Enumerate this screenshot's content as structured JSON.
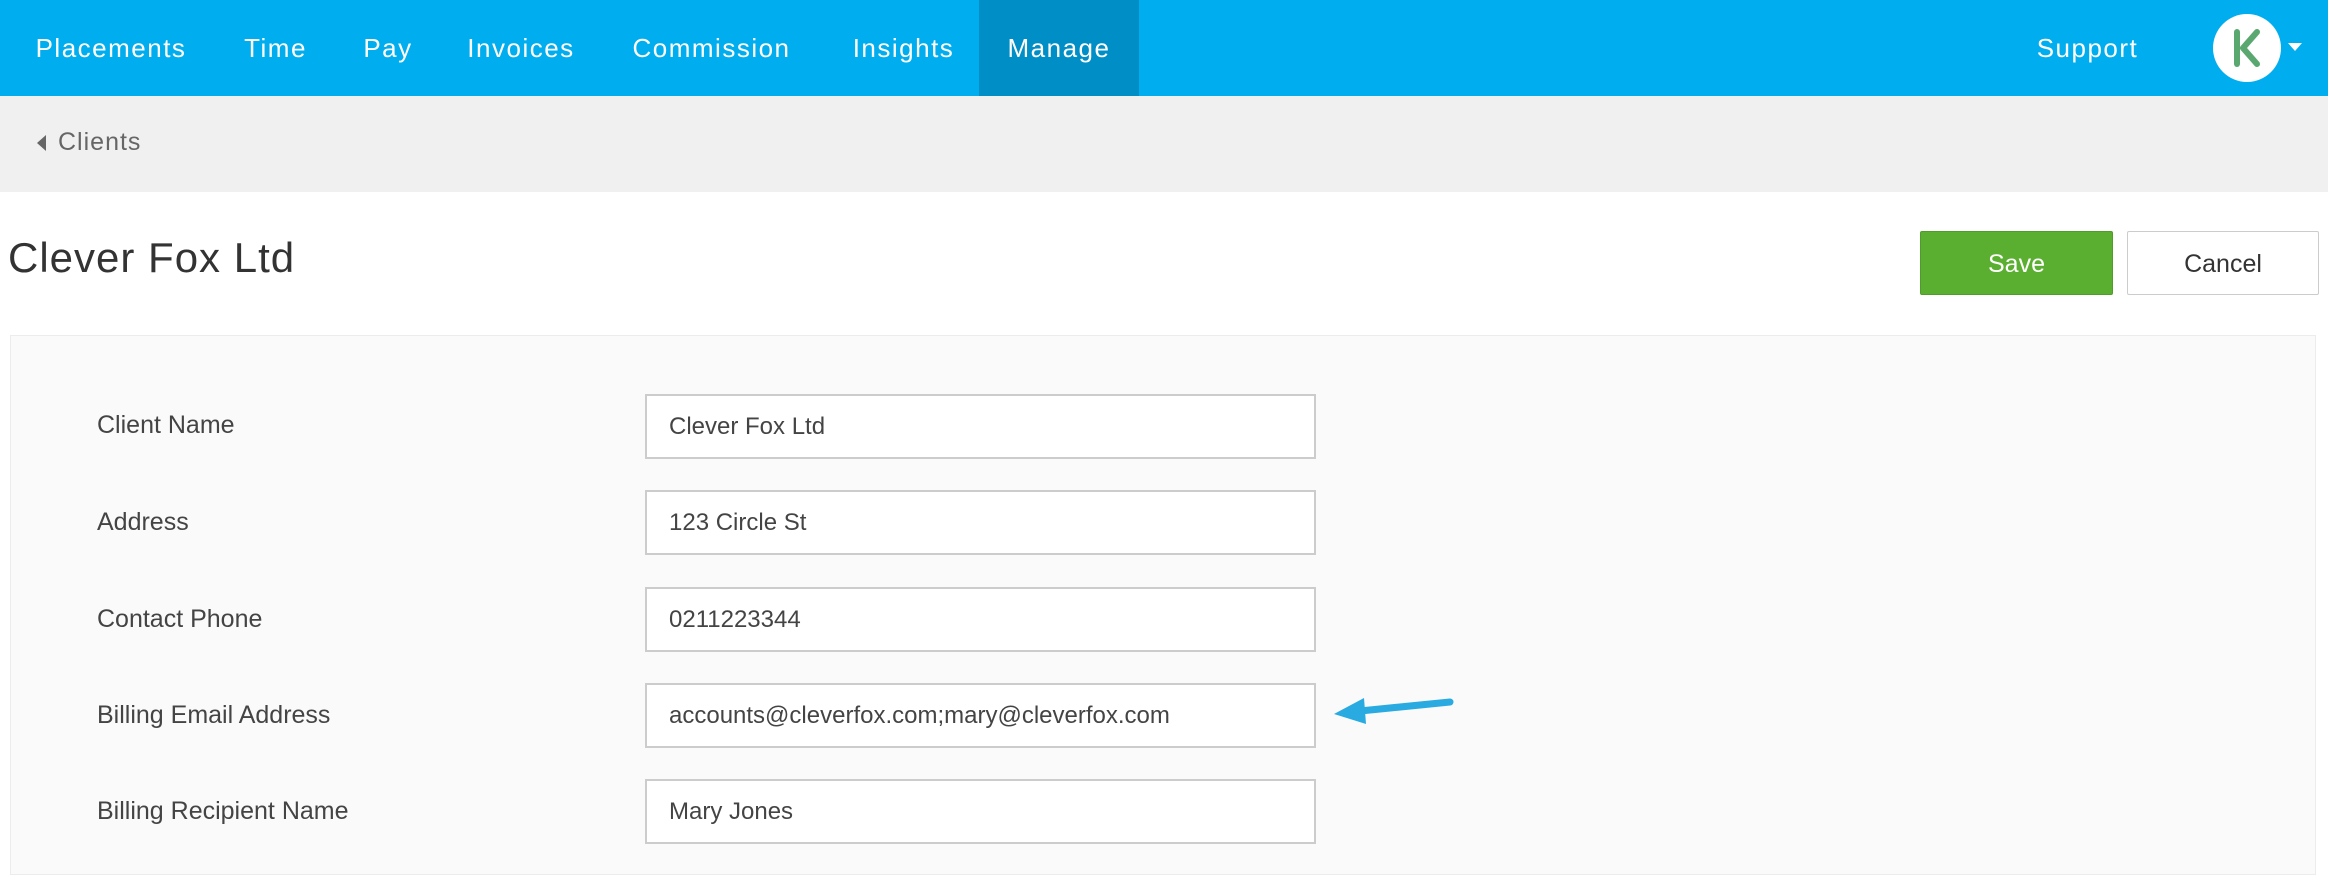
{
  "nav": {
    "items": [
      {
        "label": "Placements"
      },
      {
        "label": "Time"
      },
      {
        "label": "Pay"
      },
      {
        "label": "Invoices"
      },
      {
        "label": "Commission"
      },
      {
        "label": "Insights"
      },
      {
        "label": "Manage",
        "active": true
      }
    ],
    "support_label": "Support",
    "avatar_icon": "k-logo-icon",
    "accent_color": "#00adee"
  },
  "breadcrumb": {
    "back_label": "Clients"
  },
  "page": {
    "title": "Clever Fox Ltd",
    "save_label": "Save",
    "cancel_label": "Cancel"
  },
  "form": {
    "fields": [
      {
        "label": "Client Name",
        "value": "Clever Fox Ltd"
      },
      {
        "label": "Address",
        "value": "123 Circle St"
      },
      {
        "label": "Contact Phone",
        "value": "0211223344"
      },
      {
        "label": "Billing Email Address",
        "value": "accounts@cleverfox.com;mary@cleverfox.com"
      },
      {
        "label": "Billing Recipient Name",
        "value": "Mary Jones"
      }
    ]
  },
  "annotation": {
    "icon": "arrow-left-icon",
    "color": "#29aae1"
  }
}
